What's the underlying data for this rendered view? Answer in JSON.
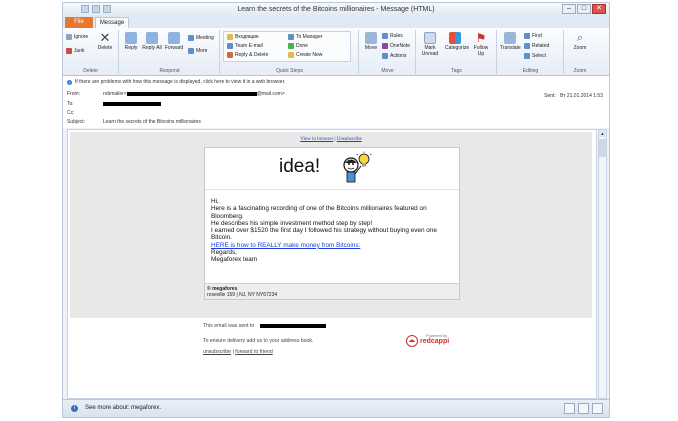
{
  "window": {
    "title": "Learn the secrets of the Bitcoins millionaires - Message (HTML)",
    "controls": {
      "minimize": "–",
      "maximize": "□",
      "close": "✕"
    }
  },
  "tabs": {
    "file": "File",
    "message": "Message"
  },
  "ribbon": {
    "delete_group": {
      "ignore": "Ignore",
      "junk": "Junk",
      "delete": "Delete",
      "label": "Delete"
    },
    "respond_group": {
      "reply": "Reply",
      "reply_all": "Reply All",
      "forward": "Forward",
      "meeting": "Meeting",
      "more": "More",
      "label": "Respond"
    },
    "quicksteps_group": {
      "item1": "Входящие",
      "item2": "Team E-mail",
      "item3": "Reply & Delete",
      "item4": "To Manager",
      "item5": "Done",
      "item6": "Create New",
      "label": "Quick Steps"
    },
    "move_group": {
      "move": "Move",
      "rules": "Rules",
      "onenote": "OneNote",
      "actions": "Actions",
      "label": "Move"
    },
    "tags_group": {
      "mark_unread": "Mark Unread",
      "categorize": "Categorize",
      "follow_up": "Follow Up",
      "label": "Tags"
    },
    "editing_group": {
      "translate": "Translate",
      "find": "Find",
      "related": "Related",
      "select": "Select",
      "label": "Editing"
    },
    "zoom_group": {
      "zoom": "Zoom",
      "label": "Zoom"
    }
  },
  "header": {
    "infobar": "If there are problems with how this message is displayed, click here to view it in a web browser.",
    "from_label": "From:",
    "from_prefix": "robmailer<",
    "from_suffix": "@mail.com>",
    "to_label": "To:",
    "cc_label": "Cc:",
    "subject_label": "Subject:",
    "subject": "Learn the secrets of the Bitcoins millionaires",
    "sent_label": "Sent:",
    "sent_value": "Вт 21.01.2014 1:53"
  },
  "email": {
    "view_in_browser": "View in browser",
    "separator": "|",
    "unsubscribe_top": "Unsubscribe",
    "banner_word": "idea!",
    "greeting": "Hi,",
    "line1": "Here is a fascinating recording of one of the Bitcoins millionaires featured on Bloomberg.",
    "line2": "He describes his simple investment method step by step!",
    "line3": "I earned over $1520 the first day I followed his strategy without buying even one Bitcoin.",
    "cta_link": "HERE is how to REALLY make money from Bitcoins:",
    "regards": "Regards,",
    "signature": "Megaforex team",
    "company": "© megafores",
    "address": "roseville 159 | NJ, NY NY67234",
    "sent_to": "This email was sent to",
    "deliver_note": "To ensure delivery add us to your address book.",
    "unsubscribe": "unsubscribe",
    "footer_sep": "|",
    "forward_friend": "forward to friend",
    "powered_by": "Powered by",
    "powered_brand": "redcappi"
  },
  "statusbar": {
    "text": "See more about: megaforex."
  },
  "colors": {
    "file_tab": "#e8772e",
    "link": "#1a3ee0",
    "accent": "#3a6fb5"
  }
}
